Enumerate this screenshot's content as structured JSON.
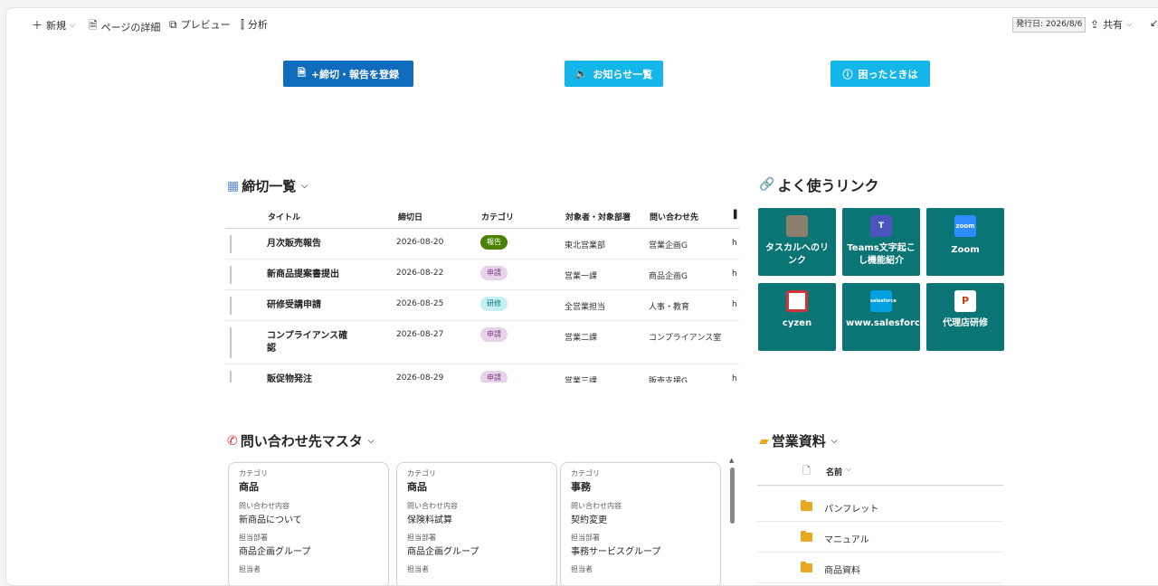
{
  "toolbar": {
    "new_label": "新規",
    "page_details_label": "ページの詳細",
    "preview_label": "プレビュー",
    "analytics_label": "分析",
    "publish_date": "発行日: 2026/8/6",
    "share_label": "共有"
  },
  "buttons": {
    "register_label": "+締切・報告を登録",
    "notices_label": "お知らせ一覧",
    "help_label": "困ったときは"
  },
  "deadlines": {
    "title": "締切一覧",
    "columns": [
      "タイトル",
      "締切日",
      "カテゴリ",
      "対象者・対象部署",
      "問い合わせ先"
    ],
    "rows": [
      {
        "title": "月次販売報告",
        "date": "2026-08-20",
        "category": "報告",
        "target": "東北営業部",
        "contact": "営業企画G",
        "extra": "h"
      },
      {
        "title": "新商品提案書提出",
        "date": "2026-08-22",
        "category": "申請",
        "target": "営業一課",
        "contact": "商品企画G",
        "extra": "h"
      },
      {
        "title": "研修受講申請",
        "date": "2026-08-25",
        "category": "研修",
        "target": "全営業担当",
        "contact": "人事・教育",
        "extra": "h"
      },
      {
        "title": "コンプライアンス確認",
        "date": "2026-08-27",
        "category": "申請",
        "target": "営業二課",
        "contact": "コンプライアンス室",
        "extra": ""
      },
      {
        "title": "販促物発注",
        "date": "2026-08-29",
        "category": "申請",
        "target": "営業三課",
        "contact": "販売支援G",
        "extra": "h"
      }
    ]
  },
  "links": {
    "title": "よく使うリンク",
    "tiles": [
      {
        "label": "タスカルへのリンク",
        "icon": "photo-thumbnail-icon"
      },
      {
        "label": "Teams文字起こし機能紹介",
        "icon": "teams-icon"
      },
      {
        "label": "Zoom",
        "icon": "zoom-icon",
        "icon_text": "zoom"
      },
      {
        "label": "cyzen",
        "icon": "cyzen-icon"
      },
      {
        "label": "www.salesforce.com",
        "icon": "salesforce-icon",
        "icon_text": "salesforce"
      },
      {
        "label": "代理店研修",
        "icon": "powerpoint-icon",
        "icon_text": "P"
      }
    ]
  },
  "contacts": {
    "title": "問い合わせ先マスタ",
    "field_labels": {
      "category": "カテゴリ",
      "content": "問い合わせ内容",
      "department": "担当部署",
      "person": "担当者"
    },
    "cards": [
      {
        "category": "商品",
        "content": "新商品について",
        "department": "商品企画グループ"
      },
      {
        "category": "商品",
        "content": "保険料試算",
        "department": "商品企画グループ"
      },
      {
        "category": "事務",
        "content": "契約変更",
        "department": "事務サービスグループ"
      }
    ]
  },
  "documents": {
    "title": "営業資料",
    "name_header": "名前",
    "items": [
      "パンフレット",
      "マニュアル",
      "商品資料"
    ]
  },
  "colors": {
    "primary_blue": "#0f6cbd",
    "cyan": "#14b5e8",
    "teal_tile": "#0b7475",
    "pill_report": "#498205",
    "pill_apply": "#e8d3ea",
    "pill_training": "#c5f0f2"
  }
}
